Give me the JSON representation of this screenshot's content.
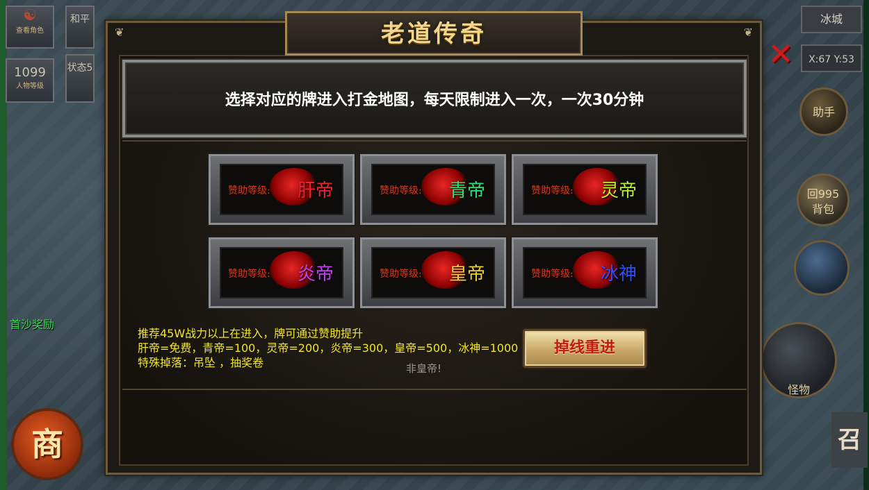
{
  "game": {
    "left_hud": {
      "view_role": "查看角色",
      "peace": "和平",
      "level_value": "1099",
      "level_label": "人物等级",
      "status": "状态5",
      "first_sand_reward": "首沙奖励",
      "shop": "商"
    },
    "right_hud": {
      "map_name": "冰城",
      "coords": "X:67 Y:53",
      "assistant": "助手",
      "recycle": "回995",
      "pack": "背包",
      "monster": "怪物",
      "summon": "召"
    }
  },
  "dialog": {
    "title": "老道传奇",
    "banner_text": "选择对应的牌进入打金地图，每天限制进入一次，一次30分钟",
    "plaque_prefix": "赞助等级:",
    "plaques": [
      {
        "tier": "肝帝",
        "color": "#e8242e"
      },
      {
        "tier": "青帝",
        "color": "#2ee07a"
      },
      {
        "tier": "灵帝",
        "color": "#b6f030"
      },
      {
        "tier": "炎帝",
        "color": "#c040f0"
      },
      {
        "tier": "皇帝",
        "color": "#f0d030"
      },
      {
        "tier": "冰神",
        "color": "#3050ff"
      }
    ],
    "info_lines": [
      "推荐45W战力以上在进入，牌可通过赞助提升",
      "肝帝=免费，青帝=100，灵帝=200，炎帝=300，皇帝=500，冰神=1000",
      "特殊掉落：吊坠 ，抽奖卷"
    ],
    "reenter_label": "掉线重进",
    "status_text": "非皇帝!",
    "close_symbol": "✕"
  }
}
